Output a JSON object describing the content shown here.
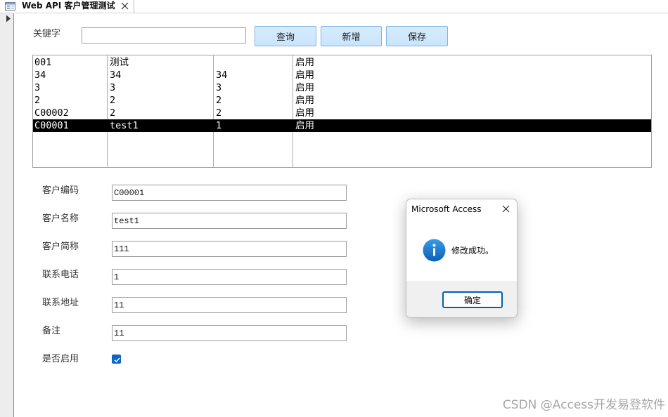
{
  "tab": {
    "title": "Web API 客户管理测试"
  },
  "search": {
    "label": "关键字",
    "value": ""
  },
  "buttons": {
    "query": "查询",
    "add": "新增",
    "save": "保存"
  },
  "list": {
    "rows": [
      {
        "cells": [
          "001",
          "测试",
          "",
          "启用"
        ],
        "selected": false
      },
      {
        "cells": [
          "34",
          "34",
          "34",
          "启用"
        ],
        "selected": false
      },
      {
        "cells": [
          "3",
          "3",
          "3",
          "启用"
        ],
        "selected": false
      },
      {
        "cells": [
          "2",
          "2",
          "2",
          "启用"
        ],
        "selected": false
      },
      {
        "cells": [
          "C00002",
          "2",
          "2",
          "启用"
        ],
        "selected": false
      },
      {
        "cells": [
          "C00001",
          "test1",
          "1",
          "启用"
        ],
        "selected": true
      }
    ]
  },
  "fields": [
    {
      "label": "客户编码",
      "value": "C00001"
    },
    {
      "label": "客户名称",
      "value": "test1"
    },
    {
      "label": "客户简称",
      "value": "111"
    },
    {
      "label": "联系电话",
      "value": "1"
    },
    {
      "label": "联系地址",
      "value": "11"
    },
    {
      "label": "备注",
      "value": "11"
    }
  ],
  "enabled": {
    "label": "是否启用",
    "checked": true
  },
  "dialog": {
    "title": "Microsoft Access",
    "message": "修改成功。",
    "ok_label": "确定"
  },
  "watermark": "CSDN @Access开发易登软件",
  "icons": {
    "tab": "form-icon",
    "tab_close": "close-icon",
    "record_selector": "record-pointer-icon",
    "dialog_close": "close-icon",
    "dialog": "info-icon",
    "checkbox": "checkmark-icon"
  },
  "colors": {
    "accent": "#0b67c6",
    "selection": "#000000",
    "button_bg": "#c9e5fb",
    "button_border": "#7fb3e6",
    "info_icon": "#1a78d0"
  }
}
